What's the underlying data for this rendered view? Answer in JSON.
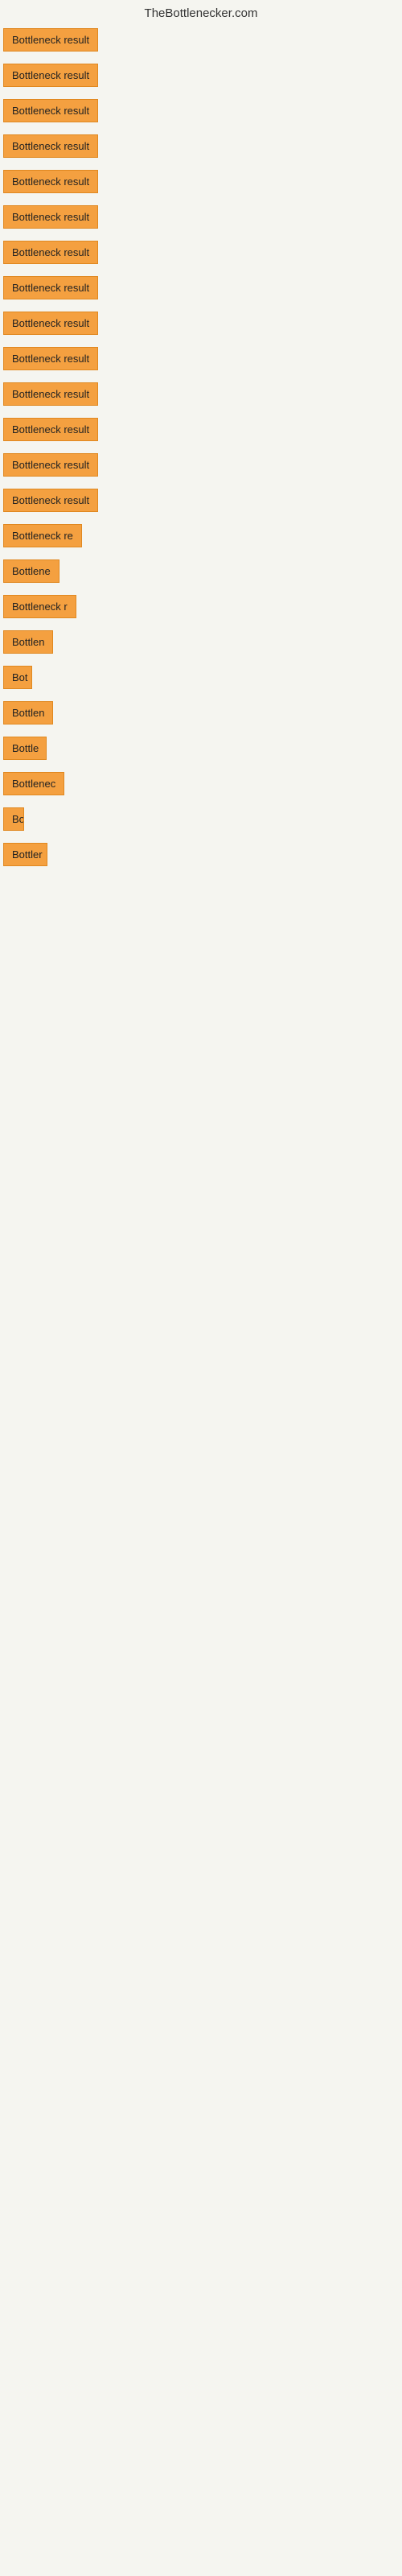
{
  "header": {
    "title": "TheBottlenecker.com"
  },
  "items": [
    {
      "label": "Bottleneck result",
      "width": 130
    },
    {
      "label": "Bottleneck result",
      "width": 130
    },
    {
      "label": "Bottleneck result",
      "width": 130
    },
    {
      "label": "Bottleneck result",
      "width": 130
    },
    {
      "label": "Bottleneck result",
      "width": 130
    },
    {
      "label": "Bottleneck result",
      "width": 130
    },
    {
      "label": "Bottleneck result",
      "width": 130
    },
    {
      "label": "Bottleneck result",
      "width": 130
    },
    {
      "label": "Bottleneck result",
      "width": 130
    },
    {
      "label": "Bottleneck result",
      "width": 130
    },
    {
      "label": "Bottleneck result",
      "width": 130
    },
    {
      "label": "Bottleneck result",
      "width": 130
    },
    {
      "label": "Bottleneck result",
      "width": 130
    },
    {
      "label": "Bottleneck result",
      "width": 130
    },
    {
      "label": "Bottleneck re",
      "width": 104
    },
    {
      "label": "Bottlene",
      "width": 78
    },
    {
      "label": "Bottleneck r",
      "width": 92
    },
    {
      "label": "Bottlen",
      "width": 66
    },
    {
      "label": "Bot",
      "width": 36
    },
    {
      "label": "Bottlen",
      "width": 66
    },
    {
      "label": "Bottle",
      "width": 54
    },
    {
      "label": "Bottlenec",
      "width": 78
    },
    {
      "label": "Bo",
      "width": 26
    },
    {
      "label": "Bottler",
      "width": 55
    }
  ]
}
